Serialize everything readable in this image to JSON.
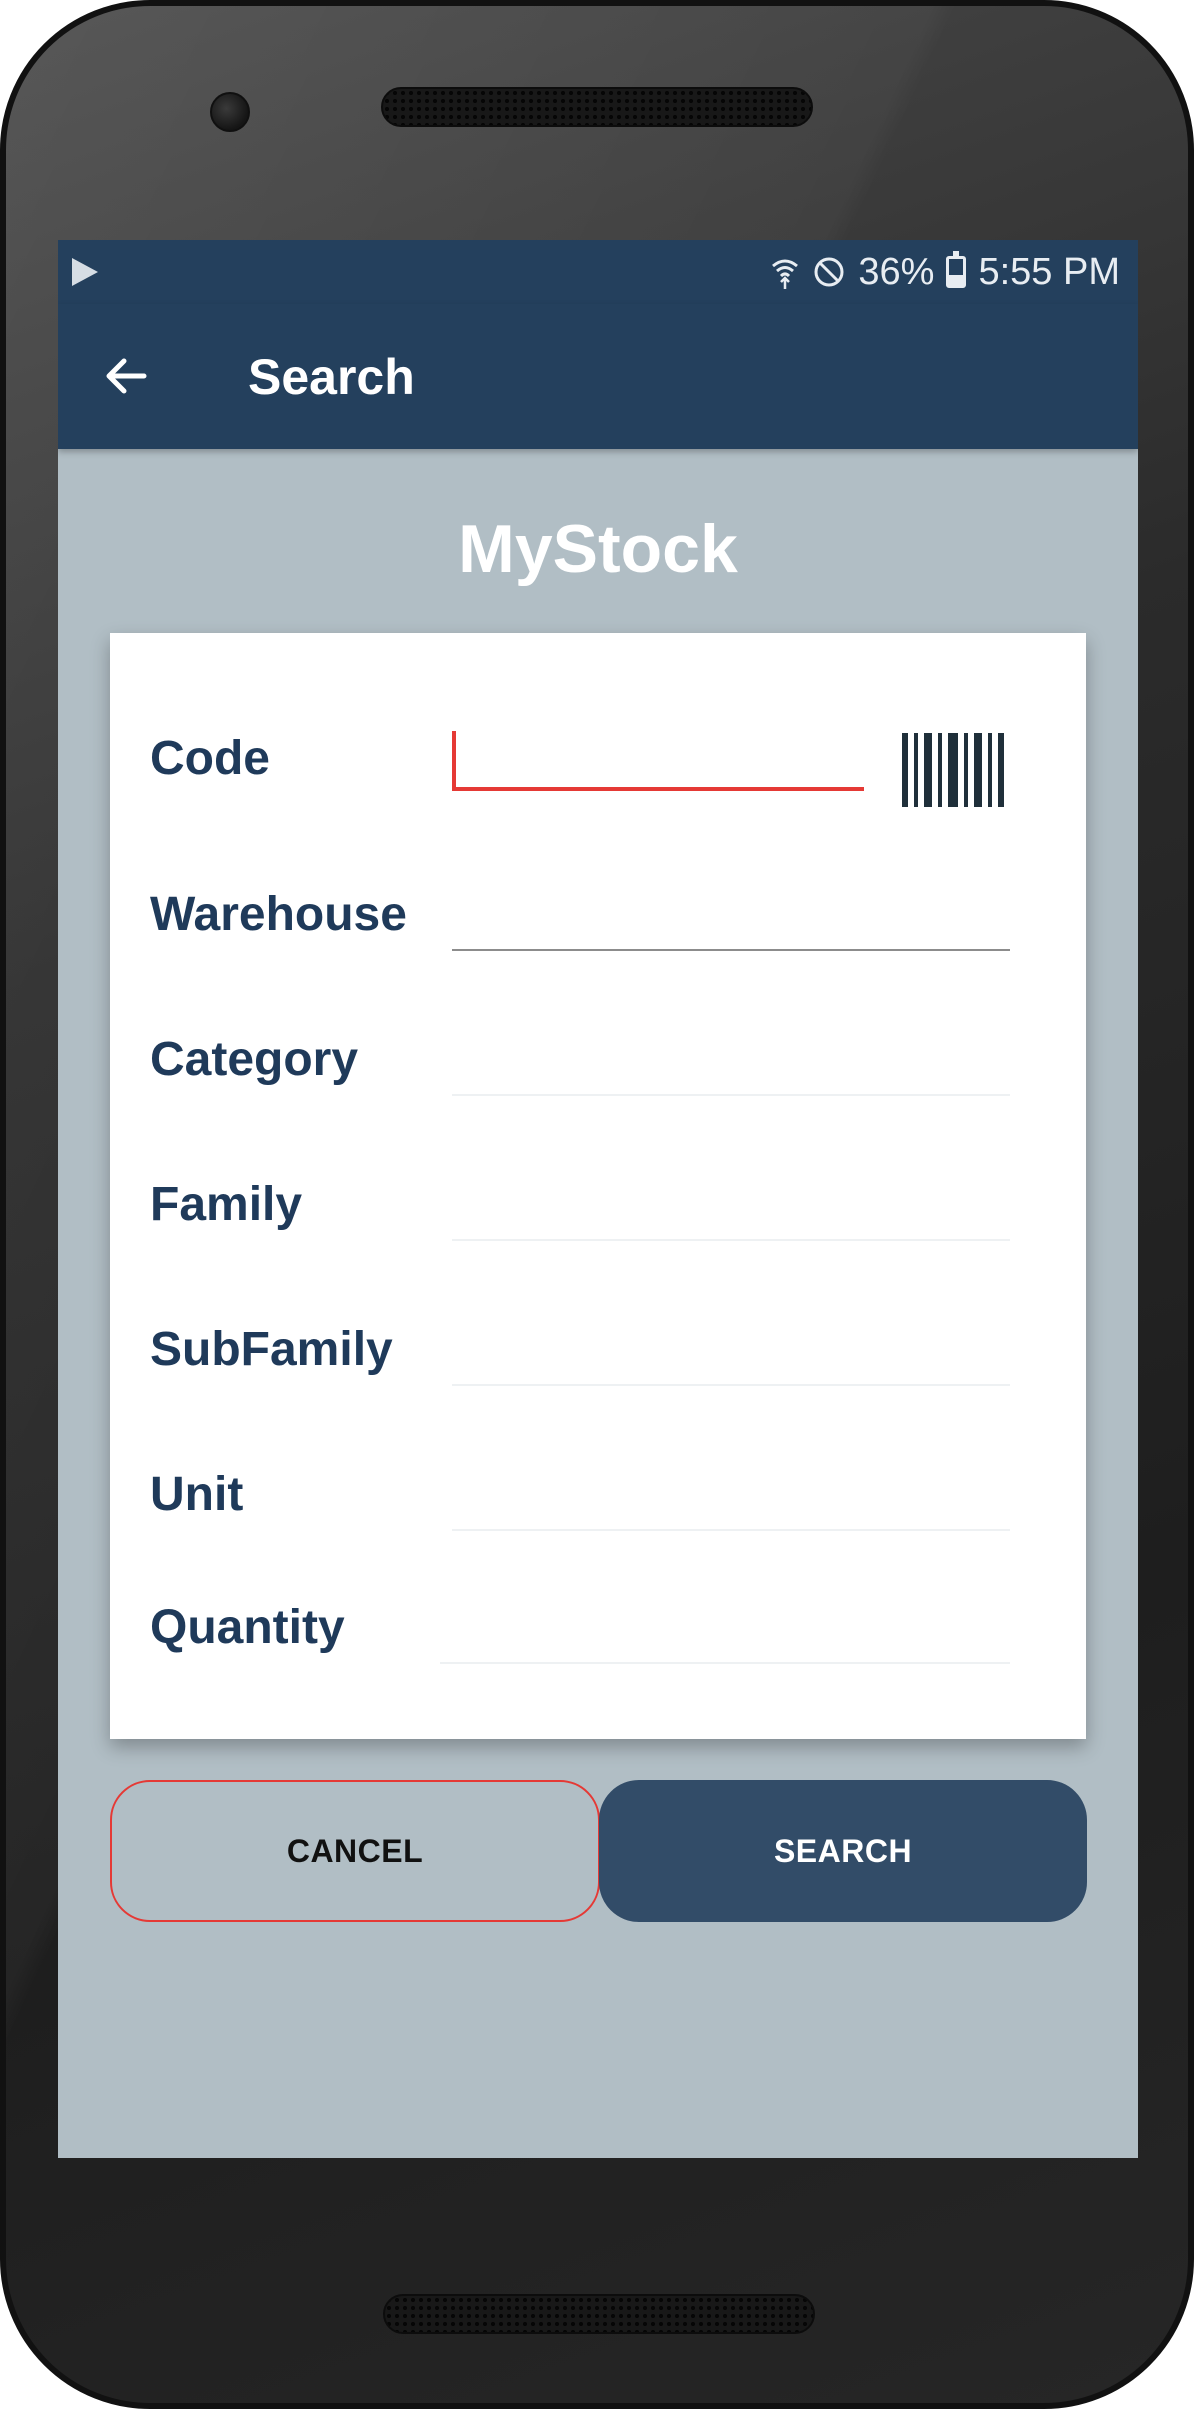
{
  "status_bar": {
    "battery_percent": "36%",
    "time": "5:55 PM",
    "icons": [
      "play-store-icon",
      "wifi-icon",
      "do-not-disturb-icon",
      "battery-charging-icon"
    ]
  },
  "app_bar": {
    "title": "Search",
    "back_icon": "arrow-left-icon"
  },
  "brand": "MyStock",
  "form": {
    "fields": [
      {
        "label": "Code",
        "value": "",
        "focused": true
      },
      {
        "label": "Warehouse",
        "value": ""
      },
      {
        "label": "Category",
        "value": ""
      },
      {
        "label": "Family",
        "value": ""
      },
      {
        "label": "SubFamily",
        "value": ""
      },
      {
        "label": "Unit",
        "value": ""
      },
      {
        "label": "Quantity",
        "value": ""
      }
    ],
    "barcode_icon": "barcode-scan-icon"
  },
  "actions": {
    "cancel_label": "CANCEL",
    "search_label": "SEARCH"
  },
  "colors": {
    "primary": "#24405d",
    "background": "#b1bec5",
    "accent": "#e53935",
    "label": "#1f3a5a",
    "button": "#324c68"
  }
}
